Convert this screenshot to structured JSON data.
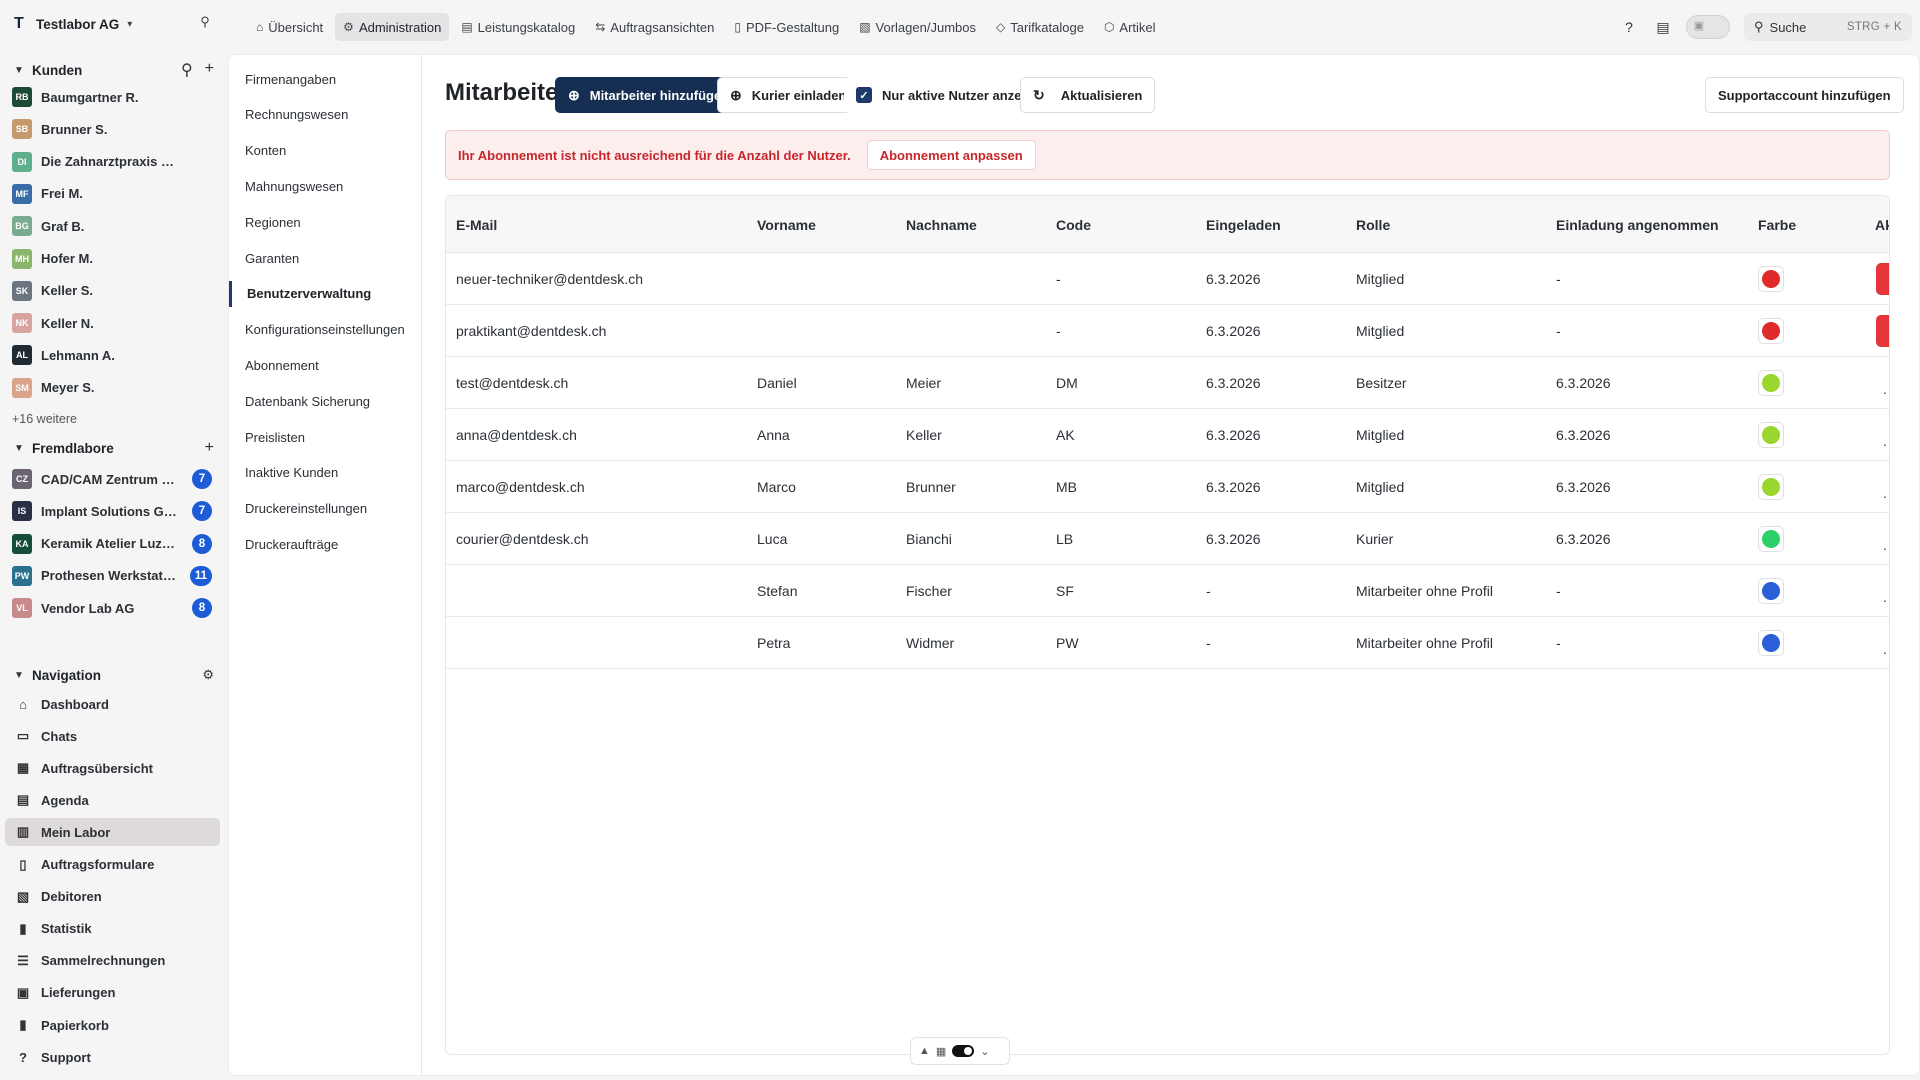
{
  "org": {
    "logo": "T",
    "name": "Testlabor AG"
  },
  "kunden": {
    "title": "Kunden",
    "items": [
      {
        "initials": "RB",
        "name": "Baumgartner R.",
        "color": "#1c4a35"
      },
      {
        "initials": "SB",
        "name": "Brunner S.",
        "color": "#c49a6c"
      },
      {
        "initials": "DI",
        "name": "Die Zahnarztpraxis GmbH",
        "color": "#5fae8c"
      },
      {
        "initials": "MF",
        "name": "Frei M.",
        "color": "#3a6da8"
      },
      {
        "initials": "BG",
        "name": "Graf B.",
        "color": "#7aab8e"
      },
      {
        "initials": "MH",
        "name": "Hofer M.",
        "color": "#8bb56a"
      },
      {
        "initials": "SK",
        "name": "Keller S.",
        "color": "#6b7580"
      },
      {
        "initials": "NK",
        "name": "Keller N.",
        "color": "#d9a4a0"
      },
      {
        "initials": "AL",
        "name": "Lehmann A.",
        "color": "#1f2a33"
      },
      {
        "initials": "SM",
        "name": "Meyer S.",
        "color": "#d9a48a"
      }
    ],
    "more": "+16 weitere"
  },
  "fremdlabore": {
    "title": "Fremdlabore",
    "items": [
      {
        "initials": "CZ",
        "name": "CAD/CAM Zentrum Ba...",
        "color": "#6b6470",
        "badge": "7"
      },
      {
        "initials": "IS",
        "name": "Implant Solutions Genf",
        "color": "#2a2f45",
        "badge": "7"
      },
      {
        "initials": "KA",
        "name": "Keramik Atelier Luzern",
        "color": "#154d3a",
        "badge": "8"
      },
      {
        "initials": "PW",
        "name": "Prothesen Werkstatt ...",
        "color": "#2d6f8f",
        "badge": "11"
      },
      {
        "initials": "VL",
        "name": "Vendor Lab AG",
        "color": "#c98a8a",
        "badge": "8"
      }
    ]
  },
  "navigation": {
    "title": "Navigation",
    "items": [
      {
        "label": "Dashboard",
        "icon": "home-icon"
      },
      {
        "label": "Chats",
        "icon": "chat-icon"
      },
      {
        "label": "Auftragsübersicht",
        "icon": "grid-icon"
      },
      {
        "label": "Agenda",
        "icon": "calendar-icon"
      },
      {
        "label": "Mein Labor",
        "icon": "lab-icon",
        "active": true
      },
      {
        "label": "Auftragsformulare",
        "icon": "clipboard-icon"
      },
      {
        "label": "Debitoren",
        "icon": "invoice-icon"
      },
      {
        "label": "Statistik",
        "icon": "chart-icon"
      },
      {
        "label": "Sammelrechnungen",
        "icon": "list-icon"
      },
      {
        "label": "Lieferungen",
        "icon": "truck-icon"
      },
      {
        "label": "Papierkorb",
        "icon": "trash-icon"
      },
      {
        "label": "Support",
        "icon": "help-icon"
      }
    ]
  },
  "topbar": {
    "tabs": [
      {
        "label": "Übersicht",
        "icon": "home-icon"
      },
      {
        "label": "Administration",
        "icon": "gear-icon",
        "active": true
      },
      {
        "label": "Leistungskatalog",
        "icon": "catalog-icon"
      },
      {
        "label": "Auftragsansichten",
        "icon": "views-icon"
      },
      {
        "label": "PDF-Gestaltung",
        "icon": "pdf-icon"
      },
      {
        "label": "Vorlagen/Jumbos",
        "icon": "template-icon"
      },
      {
        "label": "Tarifkataloge",
        "icon": "tag-icon"
      },
      {
        "label": "Artikel",
        "icon": "box-icon"
      }
    ],
    "search_label": "Suche",
    "search_shortcut": "STRG + K"
  },
  "subnav": {
    "items": [
      {
        "label": "Firmenangaben"
      },
      {
        "label": "Rechnungswesen"
      },
      {
        "label": "Konten"
      },
      {
        "label": "Mahnungswesen"
      },
      {
        "label": "Regionen"
      },
      {
        "label": "Garanten"
      },
      {
        "label": "Benutzerverwaltung",
        "active": true
      },
      {
        "label": "Konfigurationseinstellungen"
      },
      {
        "label": "Abonnement"
      },
      {
        "label": "Datenbank Sicherung"
      },
      {
        "label": "Preislisten"
      },
      {
        "label": "Inaktive Kunden"
      },
      {
        "label": "Druckereinstellungen"
      },
      {
        "label": "Druckeraufträge"
      }
    ]
  },
  "page": {
    "title": "Mitarbeiter",
    "add_button": "Mitarbeiter hinzufügen",
    "invite_button": "Kurier einladen",
    "active_only_label": "Nur aktive Nutzer anzeigen",
    "refresh_button": "Aktualisieren",
    "support_button": "Supportaccount hinzufügen",
    "alert_text": "Ihr Abonnement ist nicht ausreichend für die Anzahl der Nutzer.",
    "alert_button": "Abonnement anpassen"
  },
  "table": {
    "columns": [
      "E-Mail",
      "Vorname",
      "Nachname",
      "Code",
      "Eingeladen",
      "Rolle",
      "Einladung angenommen",
      "Farbe",
      "Ak"
    ],
    "rows": [
      {
        "email": "neuer-techniker@dentdesk.ch",
        "vorname": "",
        "nachname": "",
        "code": "-",
        "eingeladen": "6.3.2026",
        "rolle": "Mitglied",
        "angenommen": "-",
        "farbe": "#e02b2b",
        "action": "delete"
      },
      {
        "email": "praktikant@dentdesk.ch",
        "vorname": "",
        "nachname": "",
        "code": "-",
        "eingeladen": "6.3.2026",
        "rolle": "Mitglied",
        "angenommen": "-",
        "farbe": "#e02b2b",
        "action": "delete"
      },
      {
        "email": "test@dentdesk.ch",
        "vorname": "Daniel",
        "nachname": "Meier",
        "code": "DM",
        "eingeladen": "6.3.2026",
        "rolle": "Besitzer",
        "angenommen": "6.3.2026",
        "farbe": "#9ad62e",
        "action": "menu"
      },
      {
        "email": "anna@dentdesk.ch",
        "vorname": "Anna",
        "nachname": "Keller",
        "code": "AK",
        "eingeladen": "6.3.2026",
        "rolle": "Mitglied",
        "angenommen": "6.3.2026",
        "farbe": "#9ad62e",
        "action": "menu"
      },
      {
        "email": "marco@dentdesk.ch",
        "vorname": "Marco",
        "nachname": "Brunner",
        "code": "MB",
        "eingeladen": "6.3.2026",
        "rolle": "Mitglied",
        "angenommen": "6.3.2026",
        "farbe": "#9ad62e",
        "action": "menu"
      },
      {
        "email": "courier@dentdesk.ch",
        "vorname": "Luca",
        "nachname": "Bianchi",
        "code": "LB",
        "eingeladen": "6.3.2026",
        "rolle": "Kurier",
        "angenommen": "6.3.2026",
        "farbe": "#2fcf6a",
        "action": "menu"
      },
      {
        "email": "",
        "vorname": "Stefan",
        "nachname": "Fischer",
        "code": "SF",
        "eingeladen": "-",
        "rolle": "Mitarbeiter ohne Profil",
        "angenommen": "-",
        "farbe": "#2b5fd8",
        "action": "menu"
      },
      {
        "email": "",
        "vorname": "Petra",
        "nachname": "Widmer",
        "code": "PW",
        "eingeladen": "-",
        "rolle": "Mitarbeiter ohne Profil",
        "angenommen": "-",
        "farbe": "#2b5fd8",
        "action": "menu"
      }
    ]
  }
}
